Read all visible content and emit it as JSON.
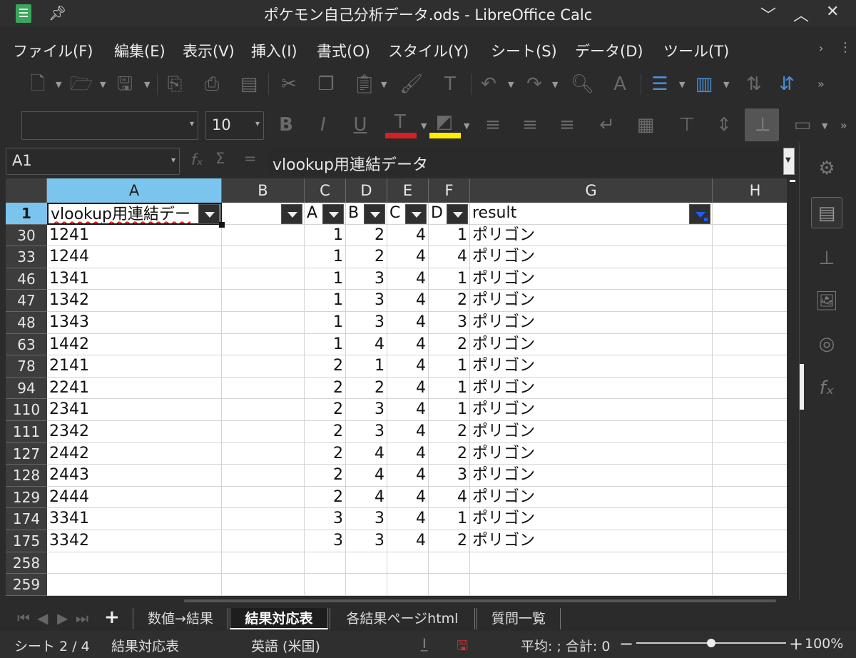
{
  "window": {
    "title": "ポケモン自己分析データ.ods - LibreOffice Calc",
    "controls": [
      "﹀",
      "︿",
      "✕"
    ]
  },
  "menu": [
    "ファイル(F)",
    "編集(E)",
    "表示(V)",
    "挿入(I)",
    "書式(O)",
    "スタイル(Y)",
    "シート(S)",
    "データ(D)",
    "ツール(T)"
  ],
  "formatting": {
    "font_name": "",
    "font_size": "10",
    "font_color": "#d42020",
    "highlight_color": "#ffee00"
  },
  "formula_bar": {
    "name_box": "A1",
    "content": "vlookup用連結データ"
  },
  "grid": {
    "columns": [
      {
        "label": "A",
        "selected": true
      },
      {
        "label": "B"
      },
      {
        "label": "C"
      },
      {
        "label": "D"
      },
      {
        "label": "E"
      },
      {
        "label": "F"
      },
      {
        "label": "G"
      },
      {
        "label": "H"
      }
    ],
    "header_row": {
      "row": "1",
      "cells": [
        "vlookup用連結デー",
        "",
        "A",
        "B",
        "C",
        "D",
        "result",
        ""
      ]
    },
    "rows": [
      {
        "row": "30",
        "cells": [
          "1241",
          "",
          "1",
          "2",
          "4",
          "1",
          "ポリゴン",
          ""
        ]
      },
      {
        "row": "33",
        "cells": [
          "1244",
          "",
          "1",
          "2",
          "4",
          "4",
          "ポリゴン",
          ""
        ]
      },
      {
        "row": "46",
        "cells": [
          "1341",
          "",
          "1",
          "3",
          "4",
          "1",
          "ポリゴン",
          ""
        ]
      },
      {
        "row": "47",
        "cells": [
          "1342",
          "",
          "1",
          "3",
          "4",
          "2",
          "ポリゴン",
          ""
        ]
      },
      {
        "row": "48",
        "cells": [
          "1343",
          "",
          "1",
          "3",
          "4",
          "3",
          "ポリゴン",
          ""
        ]
      },
      {
        "row": "63",
        "cells": [
          "1442",
          "",
          "1",
          "4",
          "4",
          "2",
          "ポリゴン",
          ""
        ]
      },
      {
        "row": "78",
        "cells": [
          "2141",
          "",
          "2",
          "1",
          "4",
          "1",
          "ポリゴン",
          ""
        ]
      },
      {
        "row": "94",
        "cells": [
          "2241",
          "",
          "2",
          "2",
          "4",
          "1",
          "ポリゴン",
          ""
        ]
      },
      {
        "row": "110",
        "cells": [
          "2341",
          "",
          "2",
          "3",
          "4",
          "1",
          "ポリゴン",
          ""
        ]
      },
      {
        "row": "111",
        "cells": [
          "2342",
          "",
          "2",
          "3",
          "4",
          "2",
          "ポリゴン",
          ""
        ]
      },
      {
        "row": "127",
        "cells": [
          "2442",
          "",
          "2",
          "4",
          "4",
          "2",
          "ポリゴン",
          ""
        ]
      },
      {
        "row": "128",
        "cells": [
          "2443",
          "",
          "2",
          "4",
          "4",
          "3",
          "ポリゴン",
          ""
        ]
      },
      {
        "row": "129",
        "cells": [
          "2444",
          "",
          "2",
          "4",
          "4",
          "4",
          "ポリゴン",
          ""
        ]
      },
      {
        "row": "174",
        "cells": [
          "3341",
          "",
          "3",
          "3",
          "4",
          "1",
          "ポリゴン",
          ""
        ]
      },
      {
        "row": "175",
        "cells": [
          "3342",
          "",
          "3",
          "3",
          "4",
          "2",
          "ポリゴン",
          ""
        ]
      },
      {
        "row": "258",
        "cells": [
          "",
          "",
          "",
          "",
          "",
          "",
          "",
          ""
        ]
      },
      {
        "row": "259",
        "cells": [
          "",
          "",
          "",
          "",
          "",
          "",
          "",
          ""
        ]
      }
    ]
  },
  "sheet_tabs": {
    "add_label": "+",
    "tabs": [
      {
        "label": "数値→結果"
      },
      {
        "label": "結果対応表",
        "active": true
      },
      {
        "label": "各結果ページhtml"
      },
      {
        "label": "質問一覧"
      }
    ]
  },
  "status": {
    "sheet_position": "シート 2 / 4",
    "sheet_name": "結果対応表",
    "language": "英語 (米国)",
    "summary": "平均: ; 合計: 0",
    "zoom": "100%",
    "zoom_fraction": 0.5
  }
}
